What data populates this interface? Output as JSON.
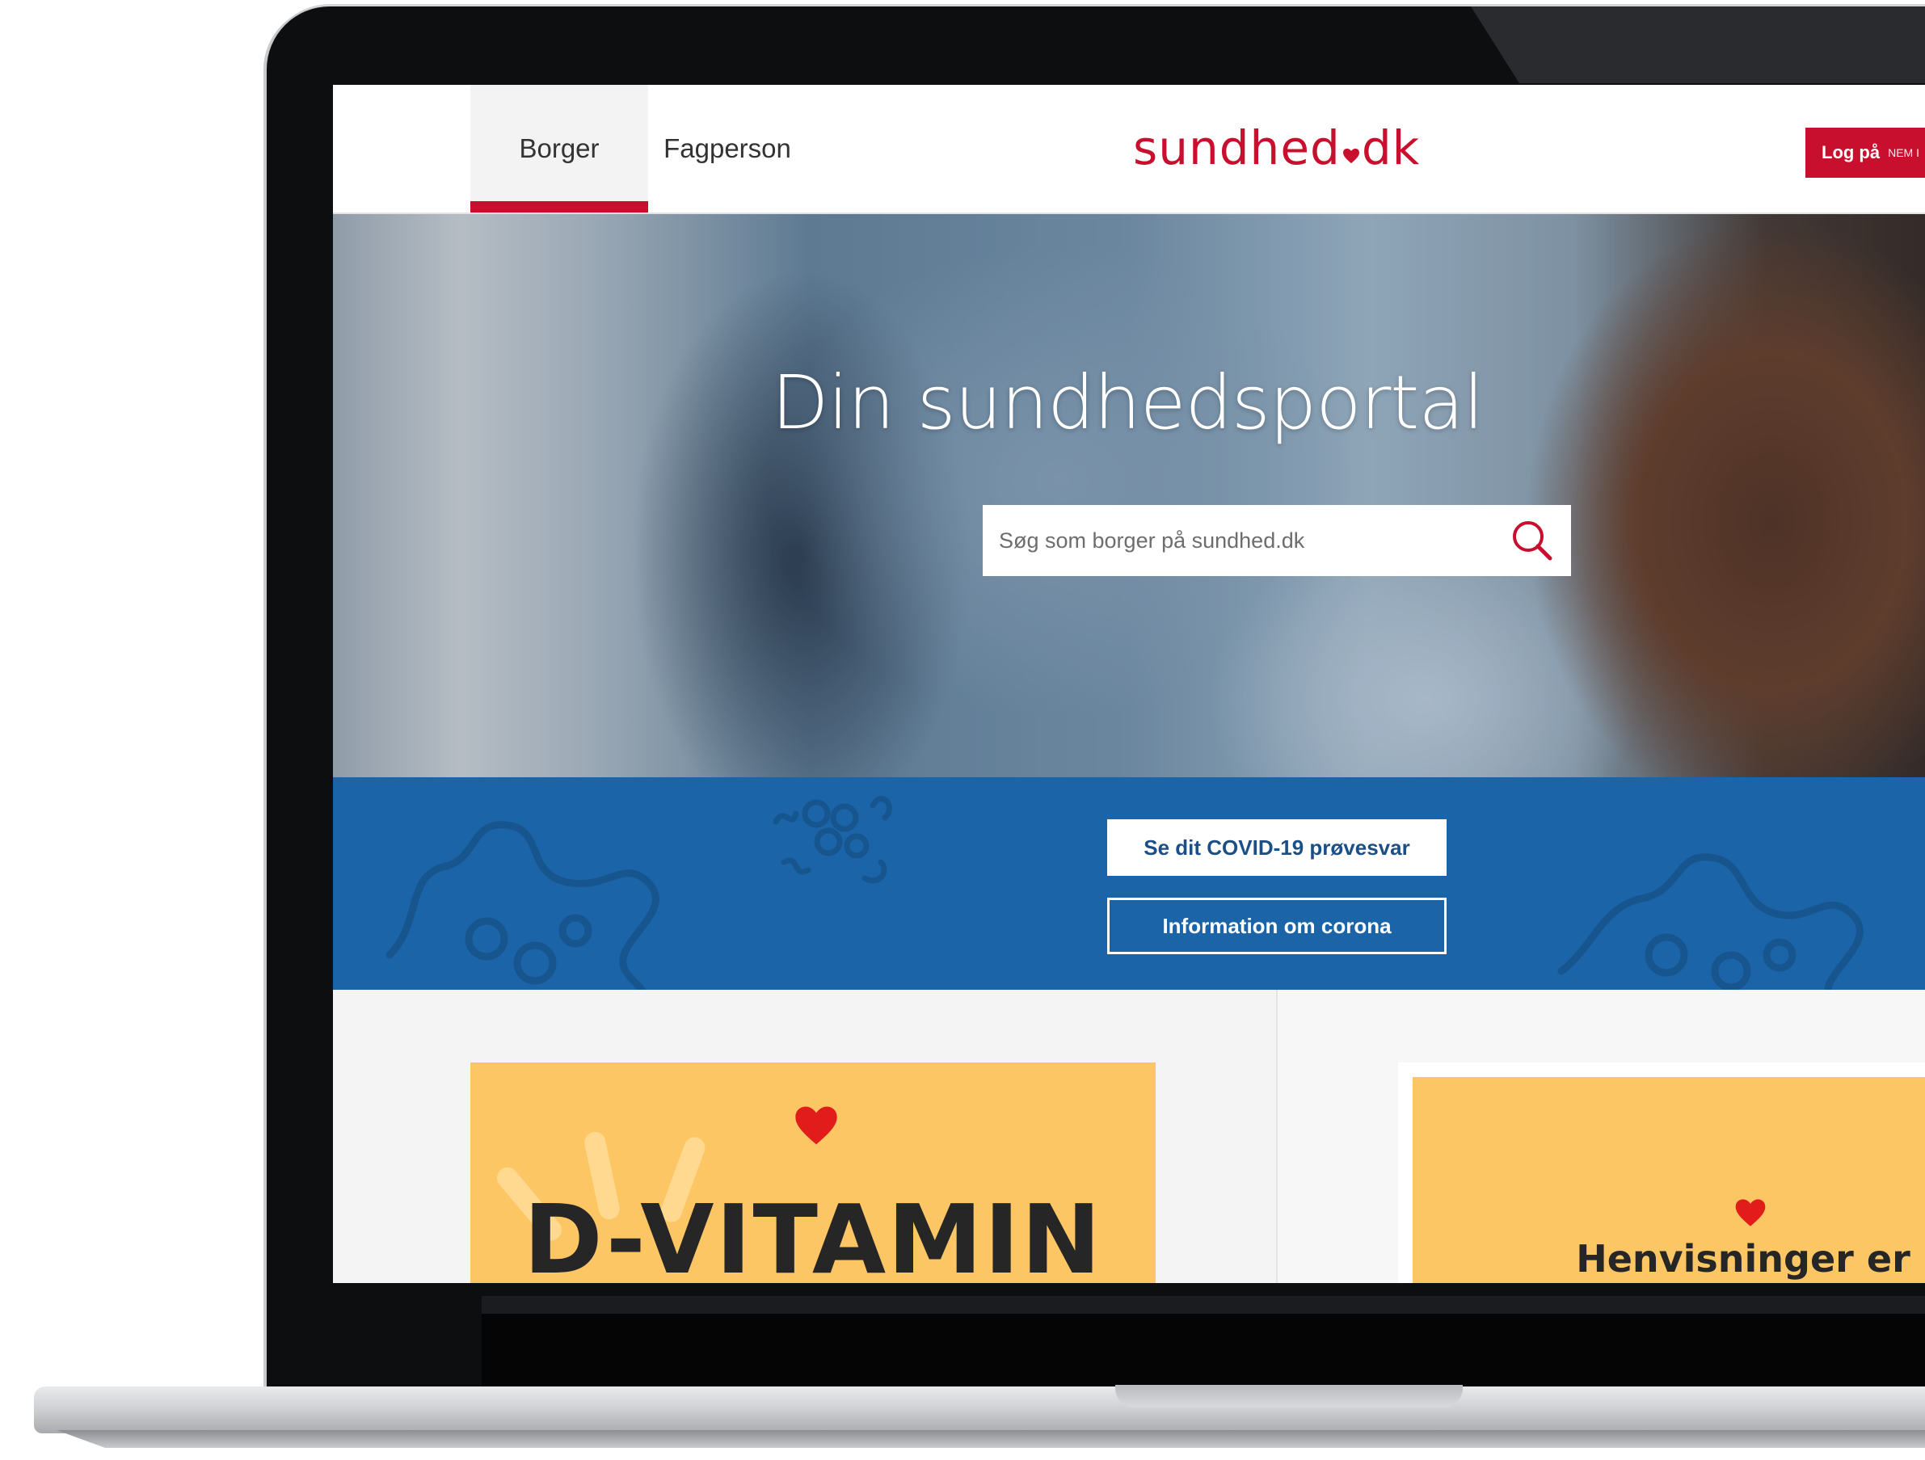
{
  "header": {
    "tabs": [
      {
        "label": "Borger",
        "active": true
      },
      {
        "label": "Fagperson",
        "active": false
      }
    ],
    "logo_main": "sundhed",
    "logo_tld": "dk",
    "login_label": "Log på",
    "login_sub": "NEM I"
  },
  "hero": {
    "title": "Din sundhedsportal",
    "search_placeholder": "Søg som borger på sundhed.dk"
  },
  "corona_band": {
    "primary_button": "Se dit COVID-19 prøvesvar",
    "secondary_button": "Information om corona"
  },
  "cards": [
    {
      "title": "D-VITAMIN"
    },
    {
      "title": "Henvisninger er"
    }
  ],
  "colors": {
    "brand_red": "#c8102e",
    "band_blue": "#1c64a8",
    "card_yellow": "#fdc664"
  }
}
